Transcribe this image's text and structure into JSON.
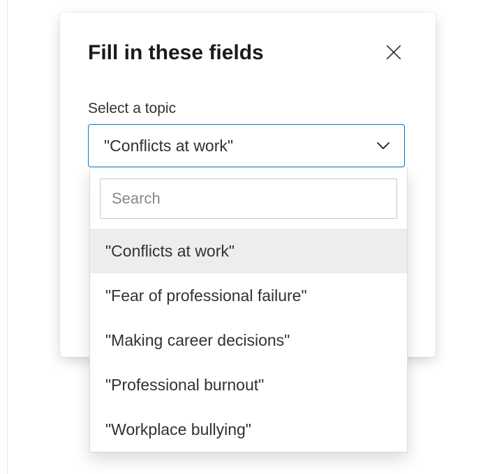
{
  "modal": {
    "title": "Fill in these fields",
    "field_label": "Select a topic",
    "selected_value": "\"Conflicts at work\""
  },
  "dropdown": {
    "search_placeholder": "Search",
    "options": [
      "\"Conflicts at work\"",
      "\"Fear of professional failure\"",
      "\"Making career decisions\"",
      "\"Professional burnout\"",
      "\"Workplace bullying\""
    ],
    "selected_index": 0
  }
}
